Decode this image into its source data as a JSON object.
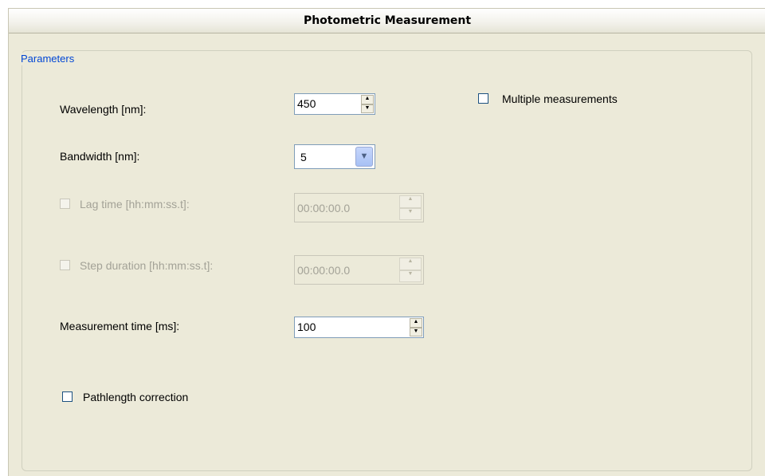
{
  "window": {
    "title": "Photometric Measurement"
  },
  "group": {
    "legend": "Parameters"
  },
  "wavelength": {
    "label": "Wavelength [nm]:",
    "value": "450"
  },
  "bandwidth": {
    "label": "Bandwidth [nm]:",
    "value": "5"
  },
  "lag_time": {
    "label": "Lag time [hh:mm:ss.t]:",
    "value": "00:00:00.0",
    "enabled": false,
    "checked": false
  },
  "step_duration": {
    "label": "Step duration [hh:mm:ss.t]:",
    "value": "00:00:00.0",
    "enabled": false,
    "checked": false
  },
  "measurement_time": {
    "label": "Measurement time [ms]:",
    "value": "100"
  },
  "pathlength_correction": {
    "label": "Pathlength correction",
    "checked": false
  },
  "multiple_measurements": {
    "label": "Multiple measurements",
    "checked": false
  },
  "icons": {
    "spin_up": "▲",
    "spin_down": "▼",
    "dropdown": "chevron-down-icon"
  },
  "colors": {
    "legend": "#0046d5",
    "panel_bg": "#ecead9",
    "disabled_text": "#a3a297"
  }
}
